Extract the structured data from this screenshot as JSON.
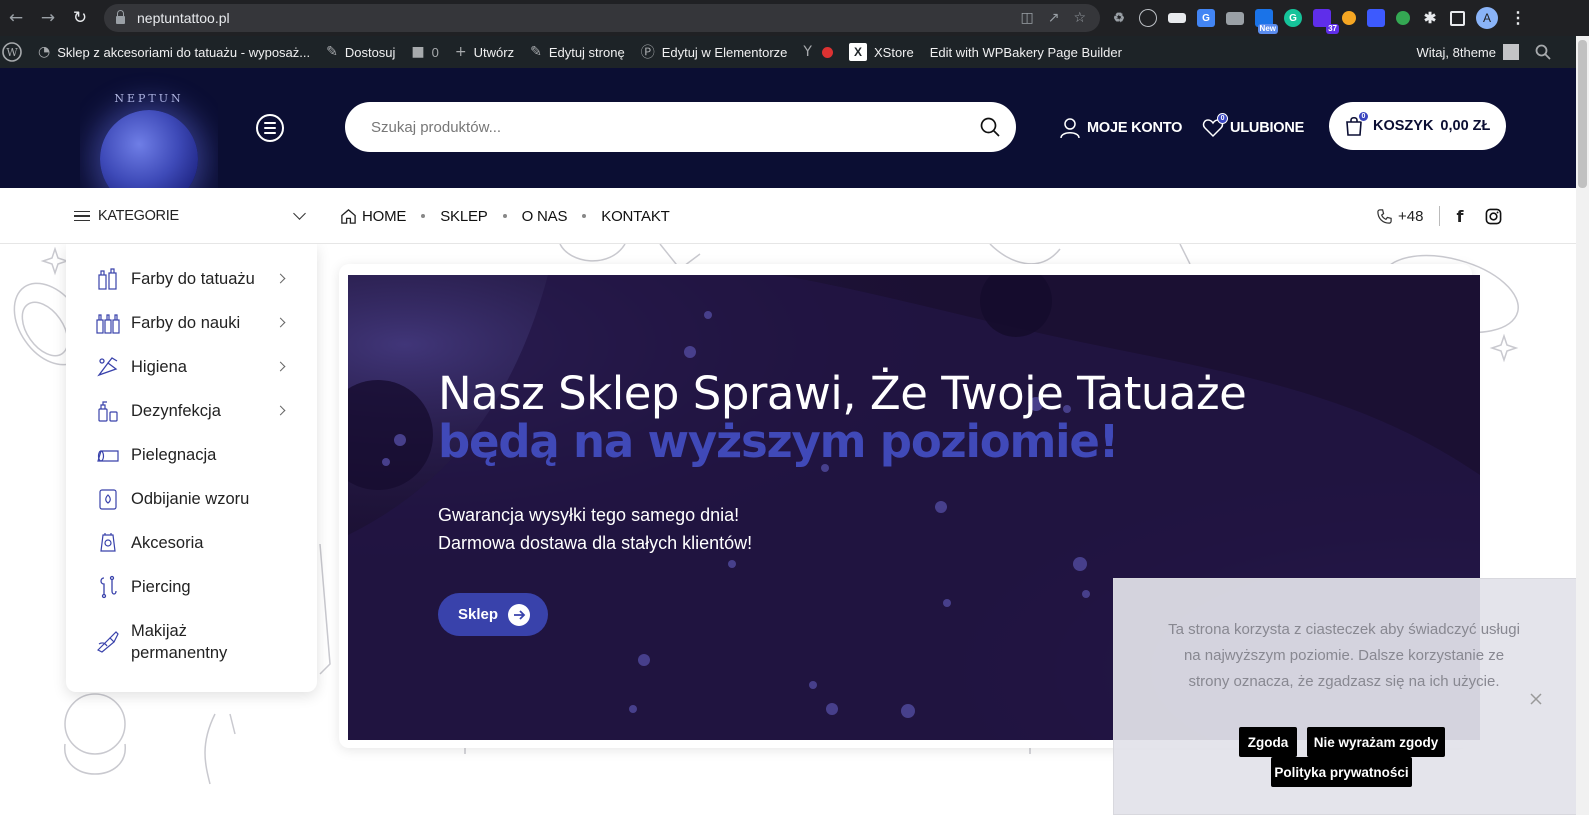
{
  "browser": {
    "url": "neptuntattoo.pl",
    "extension_badges": {
      "new": "New",
      "count": "37"
    },
    "profile_initial": "A"
  },
  "adminbar": {
    "site_name": "Sklep z akcesoriami do tatuażu - wyposaż...",
    "customize": "Dostosuj",
    "comments_count": "0",
    "new": "Utwórz",
    "edit_page": "Edytuj stronę",
    "edit_elementor": "Edytuj w Elementorze",
    "xstore": "XStore",
    "wpbakery": "Edit with WPBakery Page Builder",
    "greeting": "Witaj, 8theme"
  },
  "header": {
    "logo_text": "NEPTUN",
    "search_placeholder": "Szukaj produktów...",
    "account_label": "MOJE KONTO",
    "wishlist_label": "ULUBIONE",
    "wishlist_count": "0",
    "cart_label": "KOSZYK",
    "cart_total": "0,00 ZŁ",
    "cart_count": "0"
  },
  "navbar": {
    "categories_label": "KATEGORIE",
    "menu": [
      "HOME",
      "SKLEP",
      "O NAS",
      "KONTAKT"
    ],
    "phone": "+48"
  },
  "categories": [
    {
      "label": "Farby do tatuażu",
      "has_sub": true
    },
    {
      "label": "Farby do nauki",
      "has_sub": true
    },
    {
      "label": "Higiena",
      "has_sub": true
    },
    {
      "label": "Dezynfekcja",
      "has_sub": true
    },
    {
      "label": "Pielegnacja",
      "has_sub": false
    },
    {
      "label": "Odbijanie wzoru",
      "has_sub": false
    },
    {
      "label": "Akcesoria",
      "has_sub": false
    },
    {
      "label": "Piercing",
      "has_sub": false
    },
    {
      "label": "Makijaż permanentny",
      "has_sub": false
    }
  ],
  "banner": {
    "title_line1": "Nasz Sklep Sprawi, Że Twoje Tatuaże",
    "title_line2": "będą na wyższym poziomie!",
    "text_line1": "Gwarancja wysyłki tego samego dnia!",
    "text_line2": "Darmowa dostawa dla stałych klientów!",
    "button_label": "Sklep"
  },
  "cookie": {
    "text": "Ta strona korzysta z ciasteczek aby świadczyć usługi na najwyższym poziomie. Dalsze korzystanie ze strony oznacza, że zgadzasz się na ich użycie.",
    "accept": "Zgoda",
    "decline": "Nie wyrażam zgody",
    "privacy": "Polityka prywatności"
  },
  "colors": {
    "header_bg": "#0b0e33",
    "accent": "#3942ab",
    "banner_bg": "#1b1033"
  }
}
